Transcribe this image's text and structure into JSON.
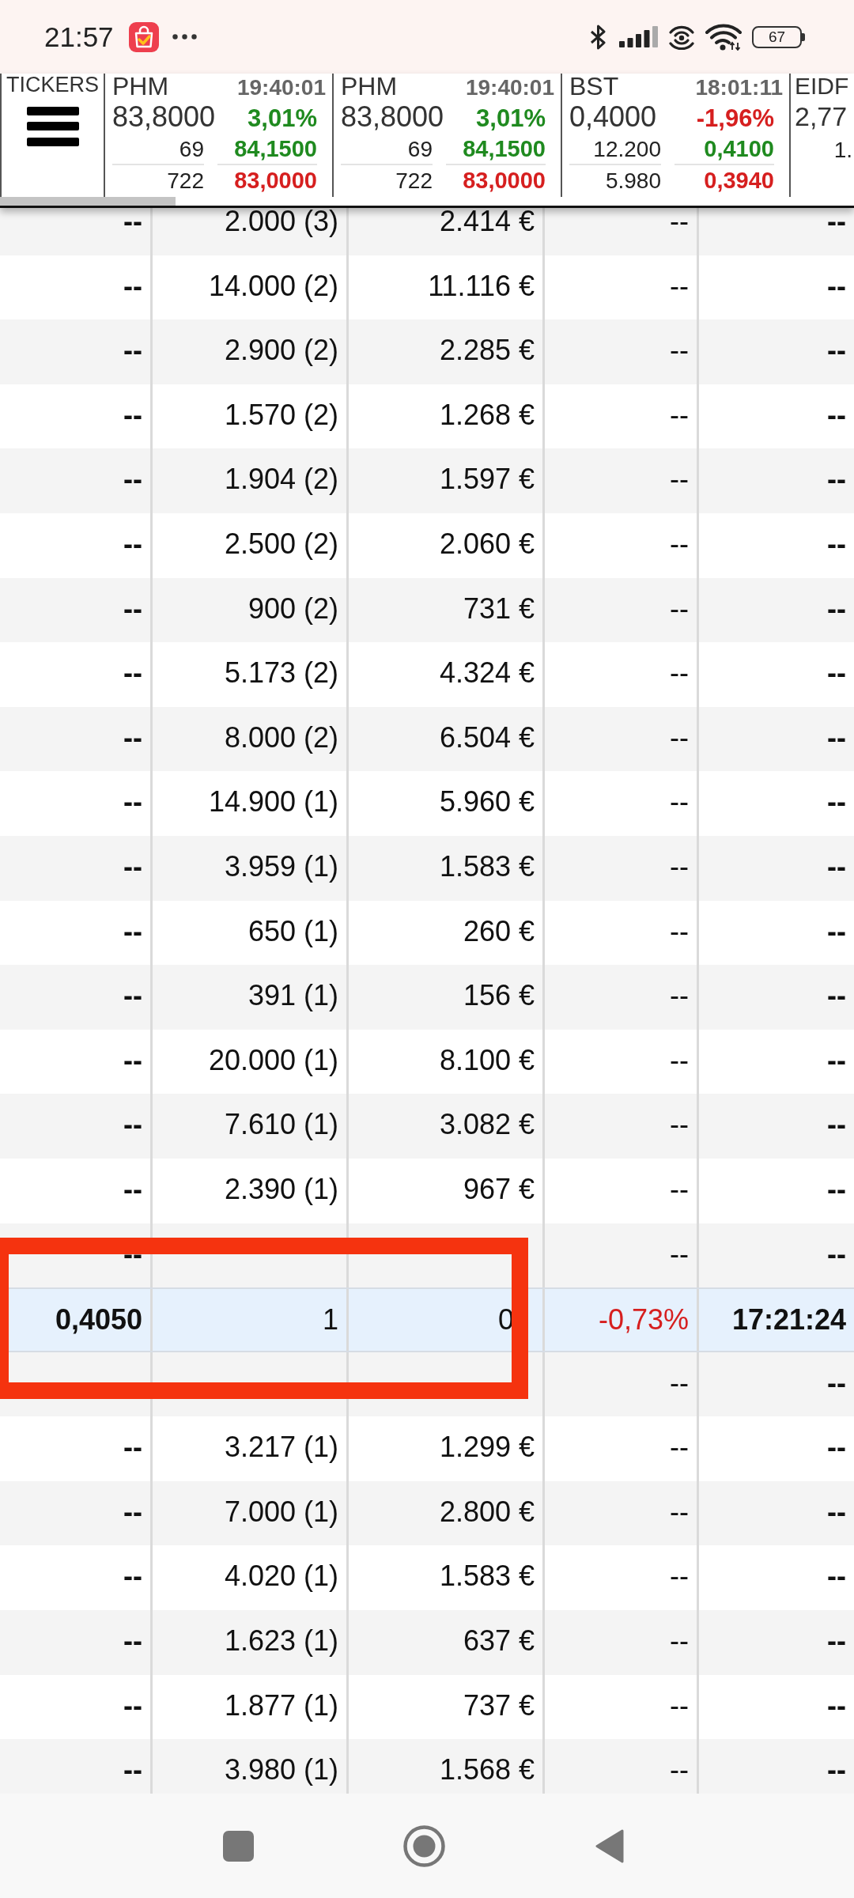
{
  "status_bar": {
    "time": "21:57",
    "battery": "67"
  },
  "ticker_bar": {
    "label": "TICKERS",
    "tickers": [
      {
        "kind": "full",
        "symbol": "PHM",
        "time": "19:40:01",
        "price": "83,8000",
        "change": "3,01%",
        "negative": false,
        "upper_count": "69",
        "upper_value": "84,1500",
        "lower_count": "722",
        "lower_value": "83,0000"
      },
      {
        "kind": "full",
        "symbol": "PHM",
        "time": "19:40:01",
        "price": "83,8000",
        "change": "3,01%",
        "negative": false,
        "upper_count": "69",
        "upper_value": "84,1500",
        "lower_count": "722",
        "lower_value": "83,0000"
      },
      {
        "kind": "full",
        "symbol": "BST",
        "time": "18:01:11",
        "price": "0,4000",
        "change": "-1,96%",
        "negative": true,
        "upper_count": "12.200",
        "upper_value": "0,4100",
        "lower_count": "5.980",
        "lower_value": "0,3940"
      },
      {
        "kind": "partial",
        "symbol": "EIDF",
        "price": "2,77",
        "upper_count": "1."
      }
    ]
  },
  "table": {
    "rows": [
      {
        "column_1": "--",
        "column_2": "2.000 (3)",
        "column_3": "2.414 €",
        "column_4": "--",
        "column_5": "--",
        "highlighted": false,
        "negative": false
      },
      {
        "column_1": "--",
        "column_2": "14.000 (2)",
        "column_3": "11.116 €",
        "column_4": "--",
        "column_5": "--",
        "highlighted": false,
        "negative": false
      },
      {
        "column_1": "--",
        "column_2": "2.900 (2)",
        "column_3": "2.285 €",
        "column_4": "--",
        "column_5": "--",
        "highlighted": false,
        "negative": false
      },
      {
        "column_1": "--",
        "column_2": "1.570 (2)",
        "column_3": "1.268 €",
        "column_4": "--",
        "column_5": "--",
        "highlighted": false,
        "negative": false
      },
      {
        "column_1": "--",
        "column_2": "1.904 (2)",
        "column_3": "1.597 €",
        "column_4": "--",
        "column_5": "--",
        "highlighted": false,
        "negative": false
      },
      {
        "column_1": "--",
        "column_2": "2.500 (2)",
        "column_3": "2.060 €",
        "column_4": "--",
        "column_5": "--",
        "highlighted": false,
        "negative": false
      },
      {
        "column_1": "--",
        "column_2": "900 (2)",
        "column_3": "731 €",
        "column_4": "--",
        "column_5": "--",
        "highlighted": false,
        "negative": false
      },
      {
        "column_1": "--",
        "column_2": "5.173 (2)",
        "column_3": "4.324 €",
        "column_4": "--",
        "column_5": "--",
        "highlighted": false,
        "negative": false
      },
      {
        "column_1": "--",
        "column_2": "8.000 (2)",
        "column_3": "6.504 €",
        "column_4": "--",
        "column_5": "--",
        "highlighted": false,
        "negative": false
      },
      {
        "column_1": "--",
        "column_2": "14.900 (1)",
        "column_3": "5.960 €",
        "column_4": "--",
        "column_5": "--",
        "highlighted": false,
        "negative": false
      },
      {
        "column_1": "--",
        "column_2": "3.959 (1)",
        "column_3": "1.583 €",
        "column_4": "--",
        "column_5": "--",
        "highlighted": false,
        "negative": false
      },
      {
        "column_1": "--",
        "column_2": "650 (1)",
        "column_3": "260 €",
        "column_4": "--",
        "column_5": "--",
        "highlighted": false,
        "negative": false
      },
      {
        "column_1": "--",
        "column_2": "391 (1)",
        "column_3": "156 €",
        "column_4": "--",
        "column_5": "--",
        "highlighted": false,
        "negative": false
      },
      {
        "column_1": "--",
        "column_2": "20.000 (1)",
        "column_3": "8.100 €",
        "column_4": "--",
        "column_5": "--",
        "highlighted": false,
        "negative": false
      },
      {
        "column_1": "--",
        "column_2": "7.610 (1)",
        "column_3": "3.082 €",
        "column_4": "--",
        "column_5": "--",
        "highlighted": false,
        "negative": false
      },
      {
        "column_1": "--",
        "column_2": "2.390 (1)",
        "column_3": "967 €",
        "column_4": "--",
        "column_5": "--",
        "highlighted": false,
        "negative": false
      },
      {
        "column_1": "--",
        "column_4": "--",
        "column_5": "--",
        "highlighted": false,
        "negative": false
      },
      {
        "column_1": "0,4050",
        "column_2": "1",
        "column_3": "0",
        "column_4": "-0,73%",
        "column_5": "17:21:24",
        "highlighted": true,
        "negative": true
      },
      {
        "column_4": "--",
        "column_5": "--",
        "highlighted": false,
        "negative": false
      },
      {
        "column_1": "--",
        "column_2": "3.217 (1)",
        "column_3": "1.299 €",
        "column_4": "--",
        "column_5": "--",
        "highlighted": false,
        "negative": false
      },
      {
        "column_1": "--",
        "column_2": "7.000 (1)",
        "column_3": "2.800 €",
        "column_4": "--",
        "column_5": "--",
        "highlighted": false,
        "negative": false
      },
      {
        "column_1": "--",
        "column_2": "4.020 (1)",
        "column_3": "1.583 €",
        "column_4": "--",
        "column_5": "--",
        "highlighted": false,
        "negative": false
      },
      {
        "column_1": "--",
        "column_2": "1.623 (1)",
        "column_3": "637 €",
        "column_4": "--",
        "column_5": "--",
        "highlighted": false,
        "negative": false
      },
      {
        "column_1": "--",
        "column_2": "1.877 (1)",
        "column_3": "737 €",
        "column_4": "--",
        "column_5": "--",
        "highlighted": false,
        "negative": false
      },
      {
        "column_1": "--",
        "column_2": "3.980 (1)",
        "column_3": "1.568 €",
        "column_4": "--",
        "column_5": "--",
        "highlighted": false,
        "negative": false
      }
    ]
  }
}
